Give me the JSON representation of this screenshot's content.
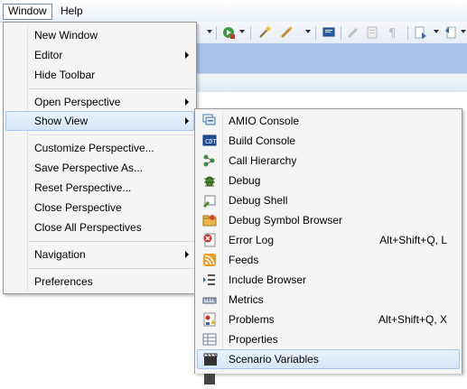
{
  "menubar": {
    "items": [
      {
        "label": "Window"
      },
      {
        "label": "Help"
      }
    ]
  },
  "window_menu": {
    "items": [
      {
        "label": "New Window"
      },
      {
        "label": "Editor",
        "submenu": true
      },
      {
        "label": "Hide Toolbar"
      },
      {
        "label": "Open Perspective",
        "submenu": true
      },
      {
        "label": "Show View",
        "submenu": true,
        "highlighted": true
      },
      {
        "label": "Customize Perspective..."
      },
      {
        "label": "Save Perspective As..."
      },
      {
        "label": "Reset Perspective..."
      },
      {
        "label": "Close Perspective"
      },
      {
        "label": "Close All Perspectives"
      },
      {
        "label": "Navigation",
        "submenu": true
      },
      {
        "label": "Preferences"
      }
    ]
  },
  "show_view_menu": {
    "items": [
      {
        "label": "AMIO Console",
        "icon": "console-stack-icon",
        "accel": ""
      },
      {
        "label": "Build Console",
        "icon": "build-console-icon",
        "accel": ""
      },
      {
        "label": "Call Hierarchy",
        "icon": "call-hierarchy-icon",
        "accel": ""
      },
      {
        "label": "Debug",
        "icon": "bug-icon",
        "accel": ""
      },
      {
        "label": "Debug Shell",
        "icon": "debug-shell-icon",
        "accel": ""
      },
      {
        "label": "Debug Symbol Browser",
        "icon": "symbol-browser-icon",
        "accel": ""
      },
      {
        "label": "Error Log",
        "icon": "error-log-icon",
        "accel": "Alt+Shift+Q, L"
      },
      {
        "label": "Feeds",
        "icon": "rss-feed-icon",
        "accel": ""
      },
      {
        "label": "Include Browser",
        "icon": "include-browser-icon",
        "accel": ""
      },
      {
        "label": "Metrics",
        "icon": "metrics-icon",
        "accel": ""
      },
      {
        "label": "Problems",
        "icon": "problems-icon",
        "accel": "Alt+Shift+Q, X"
      },
      {
        "label": "Properties",
        "icon": "properties-icon",
        "accel": ""
      },
      {
        "label": "Scenario Variables",
        "icon": "clapperboard-icon",
        "accel": "",
        "highlighted": true
      }
    ]
  },
  "colors": {
    "menu_bg": "#f5f5f5",
    "highlight": "#d5e6f8",
    "highlight_border": "#a8c7ec",
    "toolbar_band": "#a9c4e8"
  }
}
